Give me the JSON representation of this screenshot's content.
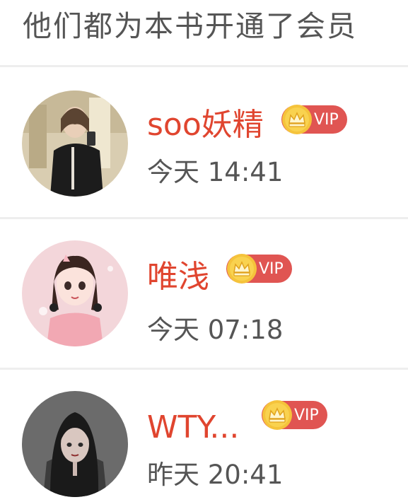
{
  "header": {
    "title": "他们都为本书开通了会员"
  },
  "members": [
    {
      "name": "soo妖精",
      "badge": "VIP",
      "time": "今天 14:41",
      "avatar": "photo-avatar"
    },
    {
      "name": "唯浅",
      "badge": "VIP",
      "time": "今天 07:18",
      "avatar": "anime-girl-pink-avatar"
    },
    {
      "name": "WTY...",
      "badge": "VIP",
      "time": "昨天 20:41",
      "avatar": "anime-girl-dark-avatar"
    }
  ],
  "colors": {
    "name": "#e0452f",
    "vip_pill": "#e05552",
    "vip_coin": "#f5c33b",
    "time": "#555555",
    "divider": "#eeeeee"
  }
}
